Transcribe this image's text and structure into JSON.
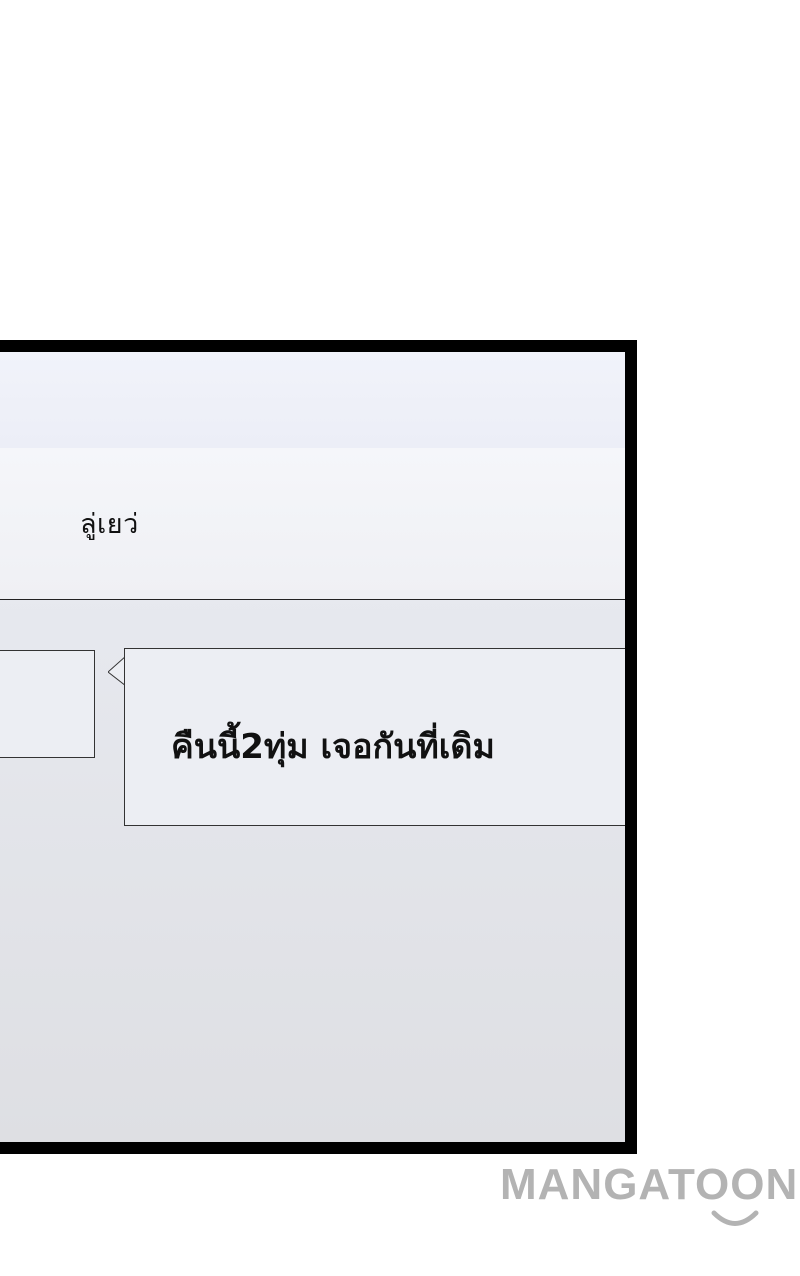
{
  "chat": {
    "contact_name": "ลู่เยว่",
    "messages": [
      {
        "side": "right",
        "text": "คืนนี้2ทุ่ม เจอกันที่เดิม"
      }
    ]
  },
  "watermark": {
    "text": "MANGATOON"
  },
  "colors": {
    "panel_border": "#000000",
    "bubble_bg": "#eceef3",
    "watermark": "#b3b3b3"
  }
}
